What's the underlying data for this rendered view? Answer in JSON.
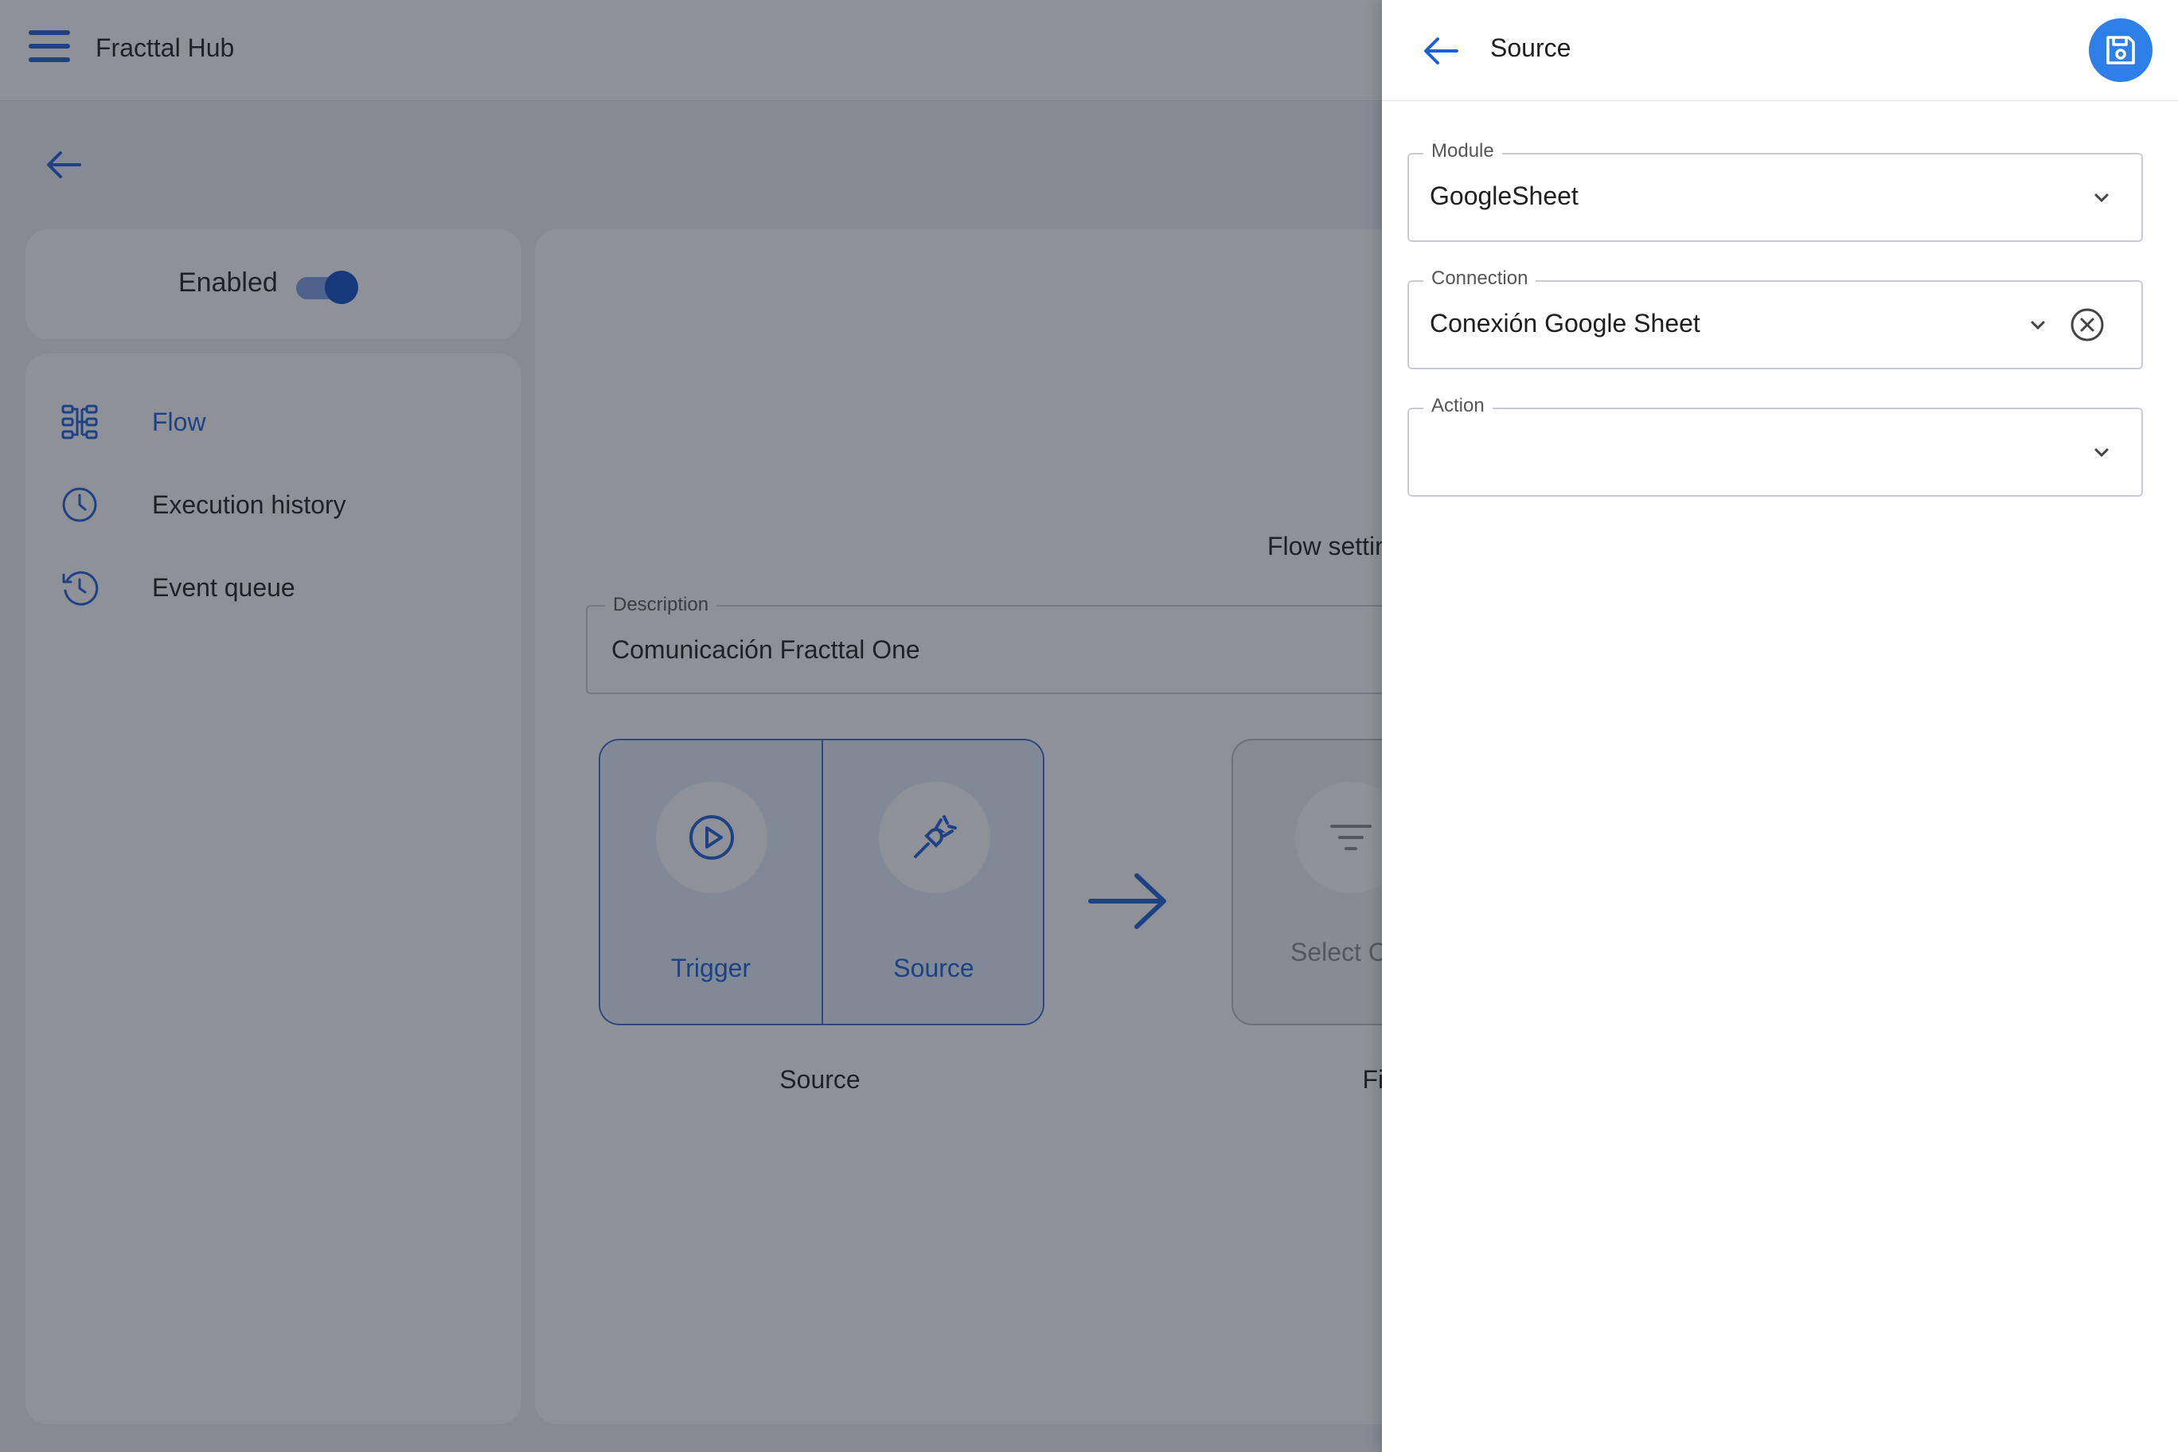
{
  "app": {
    "title": "Fracttal Hub"
  },
  "icons": {
    "menu": "hamburger-menu-icon",
    "back": "arrow-left-icon",
    "flow": "flow-diagram-icon",
    "history": "clock-icon",
    "queue": "history-icon",
    "trigger": "play-circle-icon",
    "source": "plug-icon",
    "filter": "filter-lines-icon",
    "save": "floppy-disk-icon",
    "dropdown": "chevron-down-icon",
    "clear": "close-circle-icon"
  },
  "colors": {
    "accent": "#1e5fd9",
    "save_button": "#2f7fe8",
    "toggle_on": "#0f4fc8"
  },
  "sidebar": {
    "enabled_label": "Enabled",
    "enabled": true,
    "items": [
      {
        "label": "Flow",
        "active": true
      },
      {
        "label": "Execution history",
        "active": false
      },
      {
        "label": "Event queue",
        "active": false
      }
    ]
  },
  "main": {
    "flow_settings_label": "Flow settings",
    "description": {
      "label": "Description",
      "value": "Comunicación Fracttal One"
    },
    "source_group": {
      "label": "Source",
      "tiles": [
        {
          "label": "Trigger"
        },
        {
          "label": "Source"
        }
      ]
    },
    "filter_group": {
      "label": "Filter",
      "tile_label": "Select Operator"
    }
  },
  "drawer": {
    "title": "Source",
    "fields": {
      "module": {
        "label": "Module",
        "value": "GoogleSheet"
      },
      "connection": {
        "label": "Connection",
        "value": "Conexión Google Sheet"
      },
      "action": {
        "label": "Action",
        "value": ""
      }
    }
  }
}
